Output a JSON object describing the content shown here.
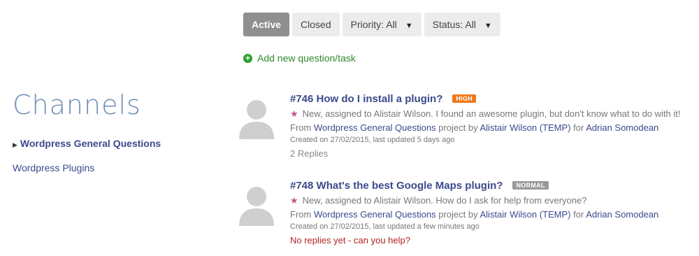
{
  "filters": {
    "active_label": "Active",
    "closed_label": "Closed",
    "priority_label": "Priority: All",
    "status_label": "Status: All"
  },
  "add_new": {
    "label": "Add new question/task"
  },
  "sidebar": {
    "title": "Channels",
    "items": [
      {
        "label": "Wordpress General Questions",
        "active": true
      },
      {
        "label": "Wordpress Plugins",
        "active": false
      }
    ]
  },
  "questions": [
    {
      "title": "#746 How do I install a plugin?",
      "badge": "HIGH",
      "badge_color": "#f07818",
      "summary": "New, assigned to Alistair Wilson. I found an awesome plugin, but don't know what to do with it!",
      "from_prefix": "From",
      "project": "Wordpress General Questions",
      "project_suffix": "project by",
      "author": "Alistair Wilson (TEMP)",
      "for_word": "for",
      "assignee": "Adrian Somodean",
      "dates": "Created on 27/02/2015, last updated 5 days ago",
      "replies": "2 Replies"
    },
    {
      "title": "#748 What's the best Google Maps plugin?",
      "badge": "NORMAL",
      "badge_color": "#999999",
      "summary": "New, assigned to Alistair Wilson. How do I ask for help from everyone?",
      "from_prefix": "From",
      "project": "Wordpress General Questions",
      "project_suffix": "project by",
      "author": "Alistair Wilson (TEMP)",
      "for_word": "for",
      "assignee": "Adrian Somodean",
      "dates": "Created on 27/02/2015, last updated a few minutes ago",
      "replies": "No replies yet - can you help?"
    }
  ],
  "colors": {
    "accent": "#3b4a8c",
    "active_button": "#8f8f8f",
    "add_green": "#2e9e2e",
    "star": "#c0538e",
    "no_reply_red": "#b22222"
  }
}
